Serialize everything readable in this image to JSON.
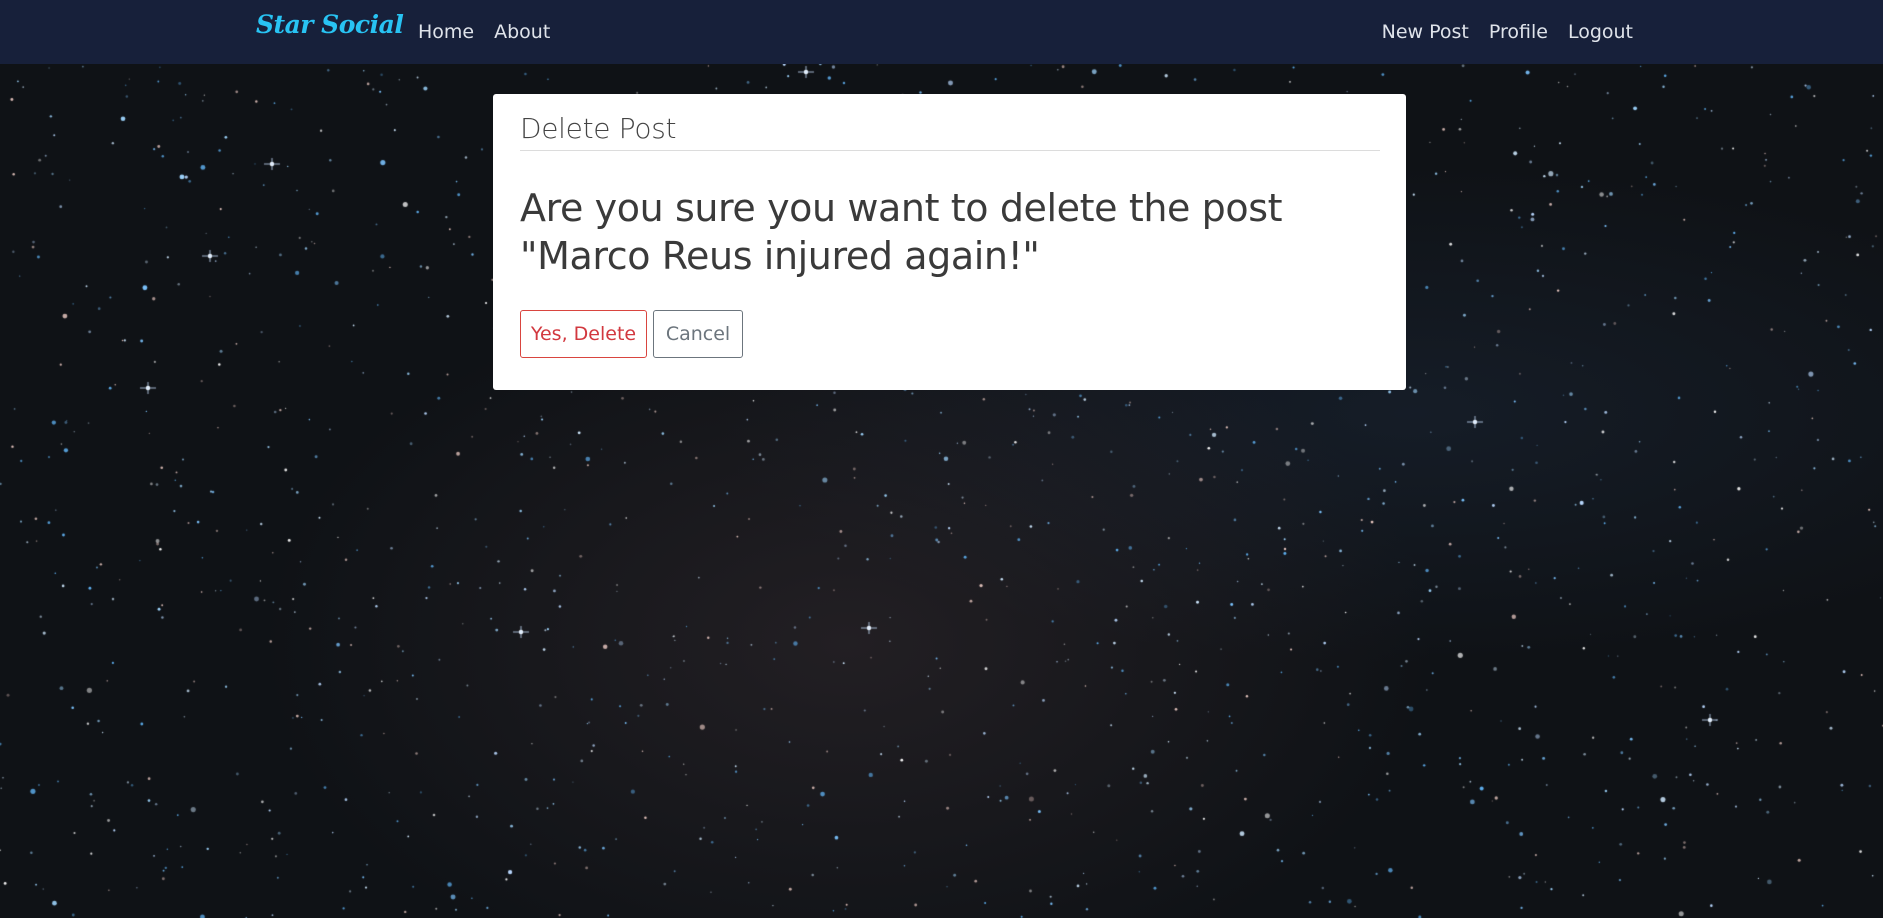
{
  "navbar": {
    "brand": "Star Social",
    "left_links": [
      "Home",
      "About"
    ],
    "right_links": [
      "New Post",
      "Profile",
      "Logout"
    ]
  },
  "dialog": {
    "legend": "Delete Post",
    "question": "Are you sure you want to delete the post \"Marco Reus injured again!\"",
    "confirm_label": "Yes, Delete",
    "cancel_label": "Cancel"
  },
  "colors": {
    "navbar_bg": "#17203a",
    "brand": "#28c3f3",
    "danger": "#d2383f",
    "secondary": "#6c757d"
  }
}
